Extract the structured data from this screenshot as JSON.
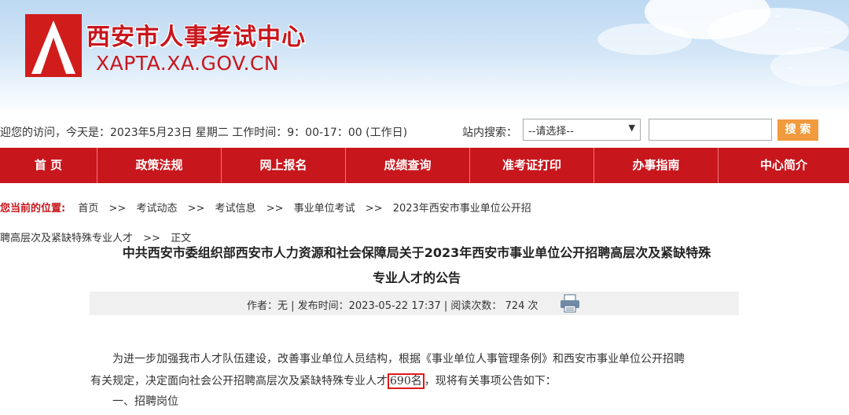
{
  "site": {
    "title": "西安市人事考试中心",
    "url": "XAPTA.XA.GOV.CN"
  },
  "infobar": {
    "welcome": "迎您的访问，今天是：2023年5月23日 星期二  工作时间：9：00-17：00 (工作日)",
    "search_label": "站内搜索：",
    "search_select": "--请选择--",
    "search_input_value": "",
    "search_button": "搜 索"
  },
  "nav": [
    {
      "label": "首 页"
    },
    {
      "label": "政策法规"
    },
    {
      "label": "网上报名"
    },
    {
      "label": "成绩查询"
    },
    {
      "label": "准考证打印"
    },
    {
      "label": "办事指南"
    },
    {
      "label": "中心简介"
    }
  ],
  "breadcrumb": {
    "here_label": "您当前的位置:",
    "items": [
      "首页",
      "考试动态",
      "考试信息",
      "事业单位考试",
      "2023年西安市事业单位公开招",
      "聘高层次及紧缺特殊专业人才",
      "正文"
    ],
    "separator": ">>"
  },
  "article": {
    "title_line1": "中共西安市委组织部西安市人力资源和社会保障局关于2023年西安市事业单位公开招聘高层次及紧缺特殊",
    "title_line2": "专业人才的公告",
    "meta": "作者：无 | 发布时间：2023-05-22 17:37 | 阅读次数： 724 次",
    "para1_line1": "为进一步加强我市人才队伍建设，改善事业单位人员结构，根据《事业单位人事管理条例》和西安市事业单位公开招聘",
    "para1_line2_a": "有关规定，决定面向社会公开招聘高层次及紧缺特殊专业人才",
    "para1_highlight": "690名",
    "para1_line2_b": "，现将有关事项公告如下：",
    "section1": "一、招聘岗位"
  },
  "colors": {
    "brand_red": "#c8161d",
    "search_orange": "#f19a3e"
  }
}
